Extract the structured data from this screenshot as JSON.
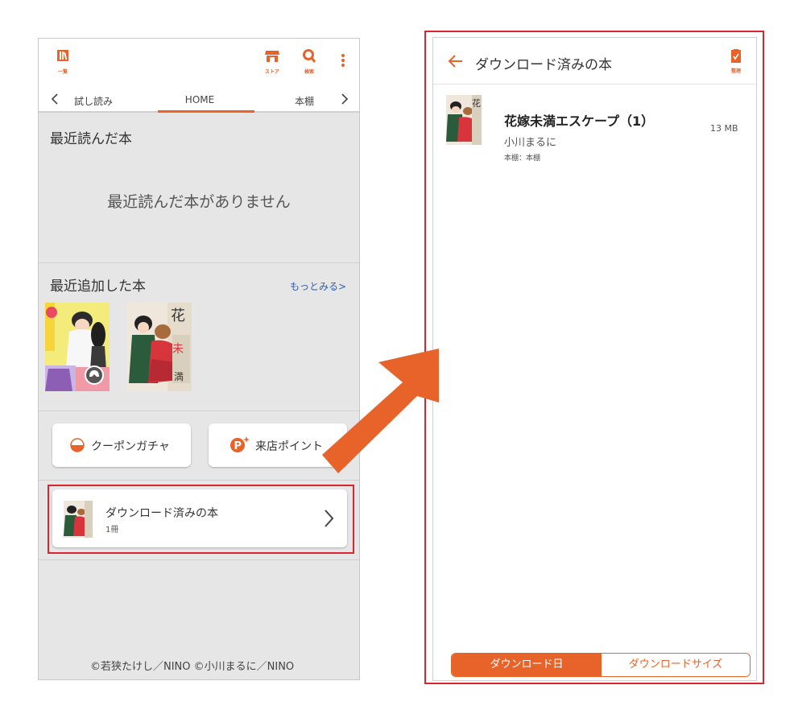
{
  "colors": {
    "accent": "#e8632a",
    "highlight": "#d9262c",
    "link": "#2b5fb4"
  },
  "left": {
    "topbar": {
      "list_label": "一覧",
      "store_label": "ストア",
      "search_label": "検索"
    },
    "tabs": {
      "prev": "試し読み",
      "current": "HOME",
      "next": "本棚"
    },
    "recent_read": {
      "title": "最近読んだ本",
      "empty": "最近読んだ本がありません"
    },
    "recent_added": {
      "title": "最近追加した本",
      "more": "もっとみる>"
    },
    "buttons": {
      "coupon": "クーポンガチャ",
      "points": "来店ポイント"
    },
    "downloaded": {
      "title": "ダウンロード済みの本",
      "count": "1冊"
    },
    "copyright": "©若狭たけし／NINO ©小川まるに／NINO"
  },
  "right": {
    "header": {
      "title": "ダウンロード済みの本",
      "manage_label": "整理"
    },
    "book": {
      "title": "花嫁未満エスケープ（1）",
      "author": "小川まるに",
      "shelf": "本棚：本棚",
      "size": "13 MB"
    },
    "sort": {
      "active": "ダウンロード日",
      "inactive": "ダウンロードサイズ"
    }
  }
}
